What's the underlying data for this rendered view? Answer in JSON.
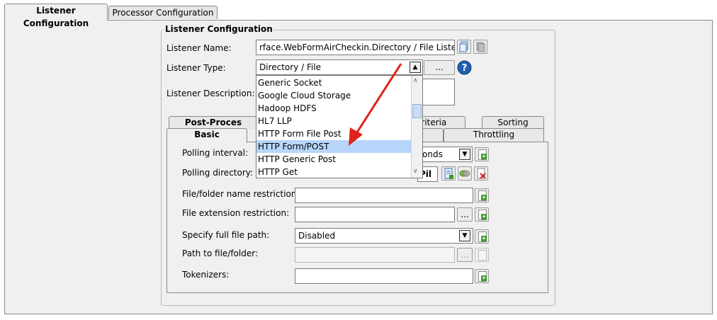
{
  "tabs": [
    "Listener Configuration",
    "Processor Configuration"
  ],
  "group_title": "Listener Configuration",
  "labels": {
    "listener_name": "Listener Name:",
    "listener_type": "Listener Type:",
    "listener_description": "Listener Description:"
  },
  "listener_name_value": "rface.WebFormAirCheckin.Directory / File Listener",
  "listener_type_value": "Directory / File",
  "ellipsis": "...",
  "dropdown_options": [
    "Generic Socket",
    "Google Cloud Storage",
    "Hadoop HDFS",
    "HL7 LLP",
    "HTTP Form File Post",
    "HTTP Form/POST",
    "HTTP Generic Post",
    "HTTP Get"
  ],
  "dropdown_selected": "HTTP Form/POST",
  "sub_tabs_back": [
    "Post-Proces",
    "Criteria",
    "Sorting"
  ],
  "sub_tabs_front": [
    "Basic",
    "Throttling"
  ],
  "fields": {
    "polling_interval": "Polling interval:",
    "polling_interval_value": "onds",
    "polling_directory": "Polling directory:",
    "polling_directory_value": "Pil",
    "name_restriction": "File/folder name restriction:",
    "ext_restriction": "File extension restriction:",
    "full_path": "Specify full file path:",
    "full_path_value": "Disabled",
    "path_to": "Path to file/folder:",
    "tokenizers": "Tokenizers:"
  },
  "colors": {
    "selection": "#b8d6fb",
    "arrow": "#e0211b",
    "help": "#1f5fae"
  },
  "icons": [
    "copy-icon",
    "paste-icon",
    "help-icon",
    "add-icon",
    "note-icon",
    "toggle-icon",
    "delete-icon"
  ]
}
